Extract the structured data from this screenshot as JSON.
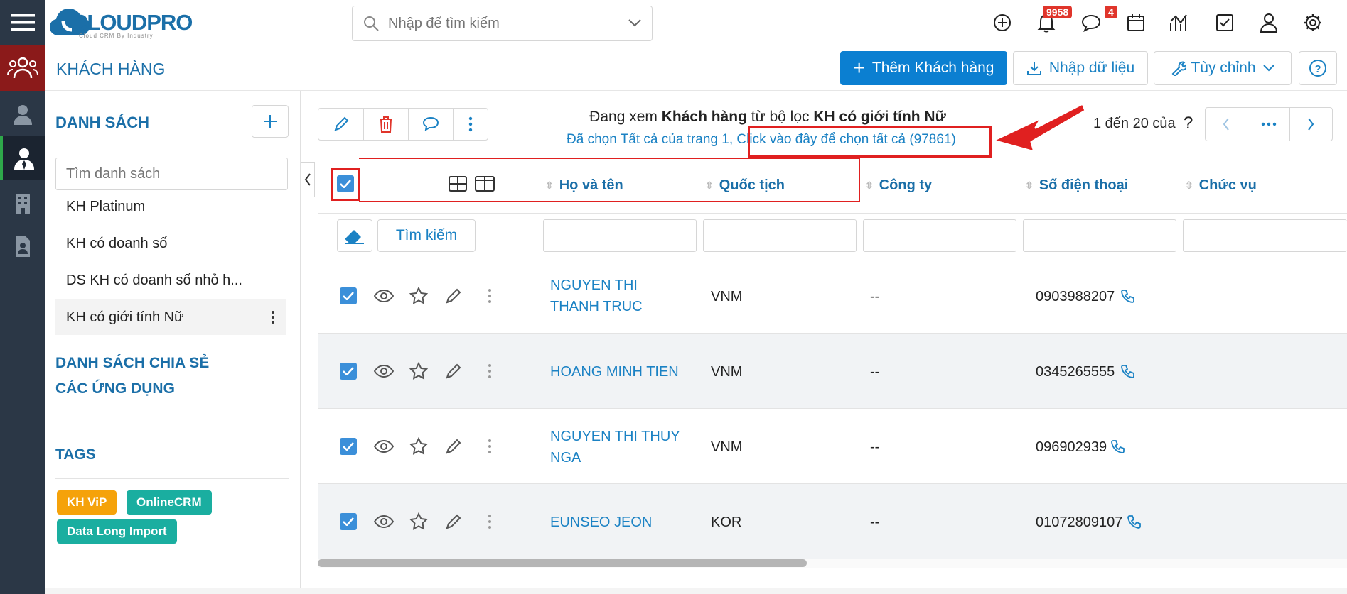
{
  "app": {
    "logo": "CLOUDPRO",
    "logo_tagline": "Cloud CRM By Industry"
  },
  "search": {
    "placeholder": "Nhập để tìm kiếm"
  },
  "header": {
    "notifications_count": "9958",
    "messages_count": "4"
  },
  "page": {
    "title": "KHÁCH HÀNG"
  },
  "actions": {
    "add_label": "Thêm Khách hàng",
    "import_label": "Nhập dữ liệu",
    "customize_label": "Tùy chỉnh"
  },
  "sidebar": {
    "lists_title": "DANH SÁCH",
    "search_placeholder": "Tìm danh sách",
    "items": [
      {
        "label": "KH Platinum"
      },
      {
        "label": "KH có doanh số"
      },
      {
        "label": "DS KH có doanh số nhỏ h..."
      },
      {
        "label": "KH có giới tính Nữ"
      }
    ],
    "shared_title": "DANH SÁCH CHIA SẺ",
    "apps_title": "CÁC ỨNG DỤNG",
    "tags_title": "TAGS",
    "tags": [
      {
        "label": "KH ViP",
        "color": "#f5a20a"
      },
      {
        "label": "OnlineCRM",
        "color": "#1aaea0"
      },
      {
        "label": "Data Long Import",
        "color": "#1aaea0"
      }
    ]
  },
  "filter_info": {
    "prefix": "Đang xem ",
    "module": "Khách hàng",
    "middle": " từ bộ lọc ",
    "filter_name": "KH có giới tính Nữ",
    "selected_text": "Đã chọn Tất cả của trang 1, ",
    "select_all_link": "Click vào đây để chọn tất cả (97861)"
  },
  "pagination": {
    "range": "1 đến 20 của",
    "total": "?"
  },
  "columns": {
    "name": "Họ và tên",
    "nationality": "Quốc tịch",
    "company": "Công ty",
    "phone": "Số điện thoại",
    "position": "Chức vụ"
  },
  "filter_row": {
    "search_button": "Tìm kiếm"
  },
  "rows": [
    {
      "name_line1": "NGUYEN THI",
      "name_line2": "THANH TRUC",
      "nationality": "VNM",
      "company": "--",
      "phone": "0903988207"
    },
    {
      "name_line1": "HOANG MINH TIEN",
      "name_line2": "",
      "nationality": "VNM",
      "company": "--",
      "phone": "0345265555"
    },
    {
      "name_line1": "NGUYEN THI THUY",
      "name_line2": "NGA",
      "nationality": "VNM",
      "company": "--",
      "phone": "096902939"
    },
    {
      "name_line1": "EUNSEO JEON",
      "name_line2": "",
      "nationality": "KOR",
      "company": "--",
      "phone": "01072809107"
    }
  ],
  "colors": {
    "accent": "#1b82c4",
    "primary_button": "#0b7fd1",
    "rail": "#2b3746",
    "rail_active": "#8b1a1a",
    "highlight": "#e02020"
  }
}
